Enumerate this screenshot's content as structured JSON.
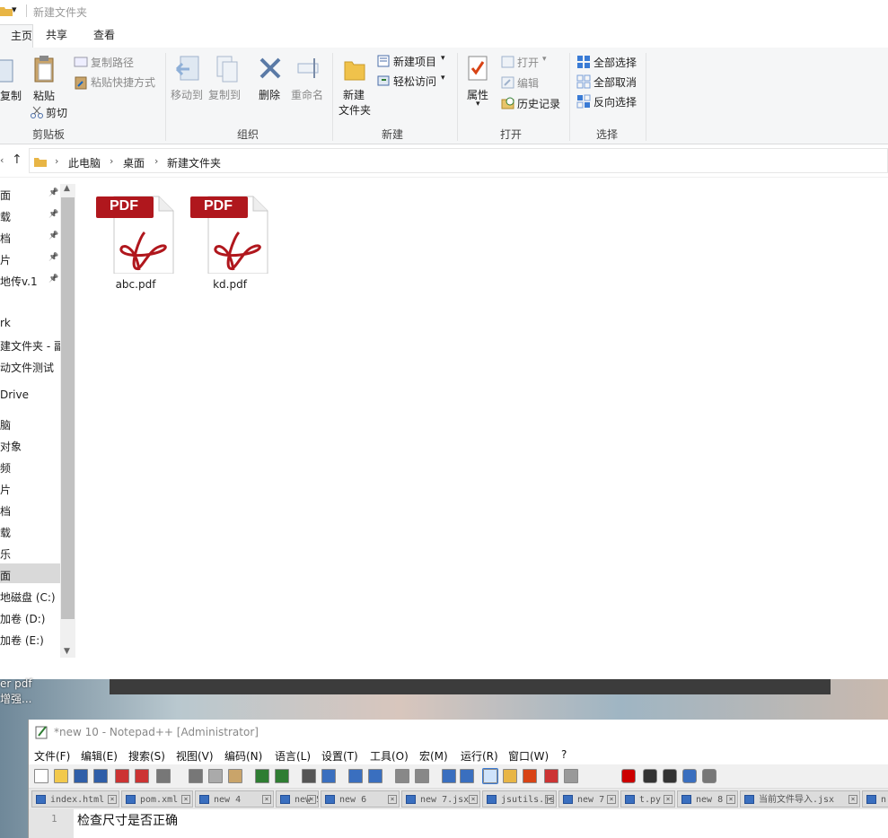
{
  "explorer": {
    "title": "新建文件夹",
    "tabs": [
      "主页",
      "共享",
      "查看"
    ],
    "ribbon": {
      "clipboard": {
        "copy": "复制",
        "paste": "粘贴",
        "copy_path": "复制路径",
        "paste_shortcut": "粘贴快捷方式",
        "cut": "剪切",
        "group": "剪贴板"
      },
      "organize": {
        "move_to": "移动到",
        "copy_to": "复制到",
        "delete": "删除",
        "rename": "重命名",
        "group": "组织"
      },
      "new": {
        "new_folder_1": "新建",
        "new_folder_2": "文件夹",
        "new_item": "新建项目",
        "easy_access": "轻松访问",
        "group": "新建"
      },
      "open": {
        "properties": "属性",
        "open": "打开",
        "edit": "编辑",
        "history": "历史记录",
        "group": "打开"
      },
      "select": {
        "select_all": "全部选择",
        "select_none": "全部取消",
        "invert": "反向选择",
        "group": "选择"
      }
    },
    "breadcrumb": [
      "此电脑",
      "桌面",
      "新建文件夹"
    ],
    "nav_items": [
      {
        "label": "面",
        "pinned": true
      },
      {
        "label": "载",
        "pinned": true
      },
      {
        "label": "档",
        "pinned": true
      },
      {
        "label": "片",
        "pinned": true
      },
      {
        "label": "地传v.1",
        "pinned": true
      },
      {
        "label": "rk",
        "pinned": false
      },
      {
        "label": "建文件夹 - 副",
        "pinned": false
      },
      {
        "label": "动文件测试",
        "pinned": false
      },
      {
        "label": "Drive",
        "pinned": false
      },
      {
        "label": "脑",
        "pinned": false
      },
      {
        "label": "对象",
        "pinned": false
      },
      {
        "label": "频",
        "pinned": false
      },
      {
        "label": "片",
        "pinned": false
      },
      {
        "label": "档",
        "pinned": false
      },
      {
        "label": "载",
        "pinned": false
      },
      {
        "label": "乐",
        "pinned": false
      },
      {
        "label": "面",
        "pinned": false,
        "selected": true
      },
      {
        "label": "地磁盘 (C:)",
        "pinned": false
      },
      {
        "label": "加卷 (D:)",
        "pinned": false
      },
      {
        "label": "加卷 (E:)",
        "pinned": false
      }
    ],
    "files": [
      {
        "name": "abc.pdf",
        "badge": "PDF"
      },
      {
        "name": "kd.pdf",
        "badge": "PDF"
      }
    ]
  },
  "desktop": {
    "label_line1": "er pdf",
    "label_line2": "增强..."
  },
  "notepad": {
    "title": "*new 10 - Notepad++ [Administrator]",
    "menu": [
      "文件(F)",
      "编辑(E)",
      "搜索(S)",
      "视图(V)",
      "编码(N)",
      "语言(L)",
      "设置(T)",
      "工具(O)",
      "宏(M)",
      "运行(R)",
      "窗口(W)",
      "?"
    ],
    "tabs": [
      "index.html",
      "pom.xml",
      "new 4",
      "new 5",
      "new 6",
      "new 7.jsx",
      "jsutils.js",
      "new 7",
      "t.py",
      "new 8",
      "当前文件导入.jsx",
      "n"
    ],
    "line_number": "1",
    "line_text": "检查尺寸是否正确"
  }
}
